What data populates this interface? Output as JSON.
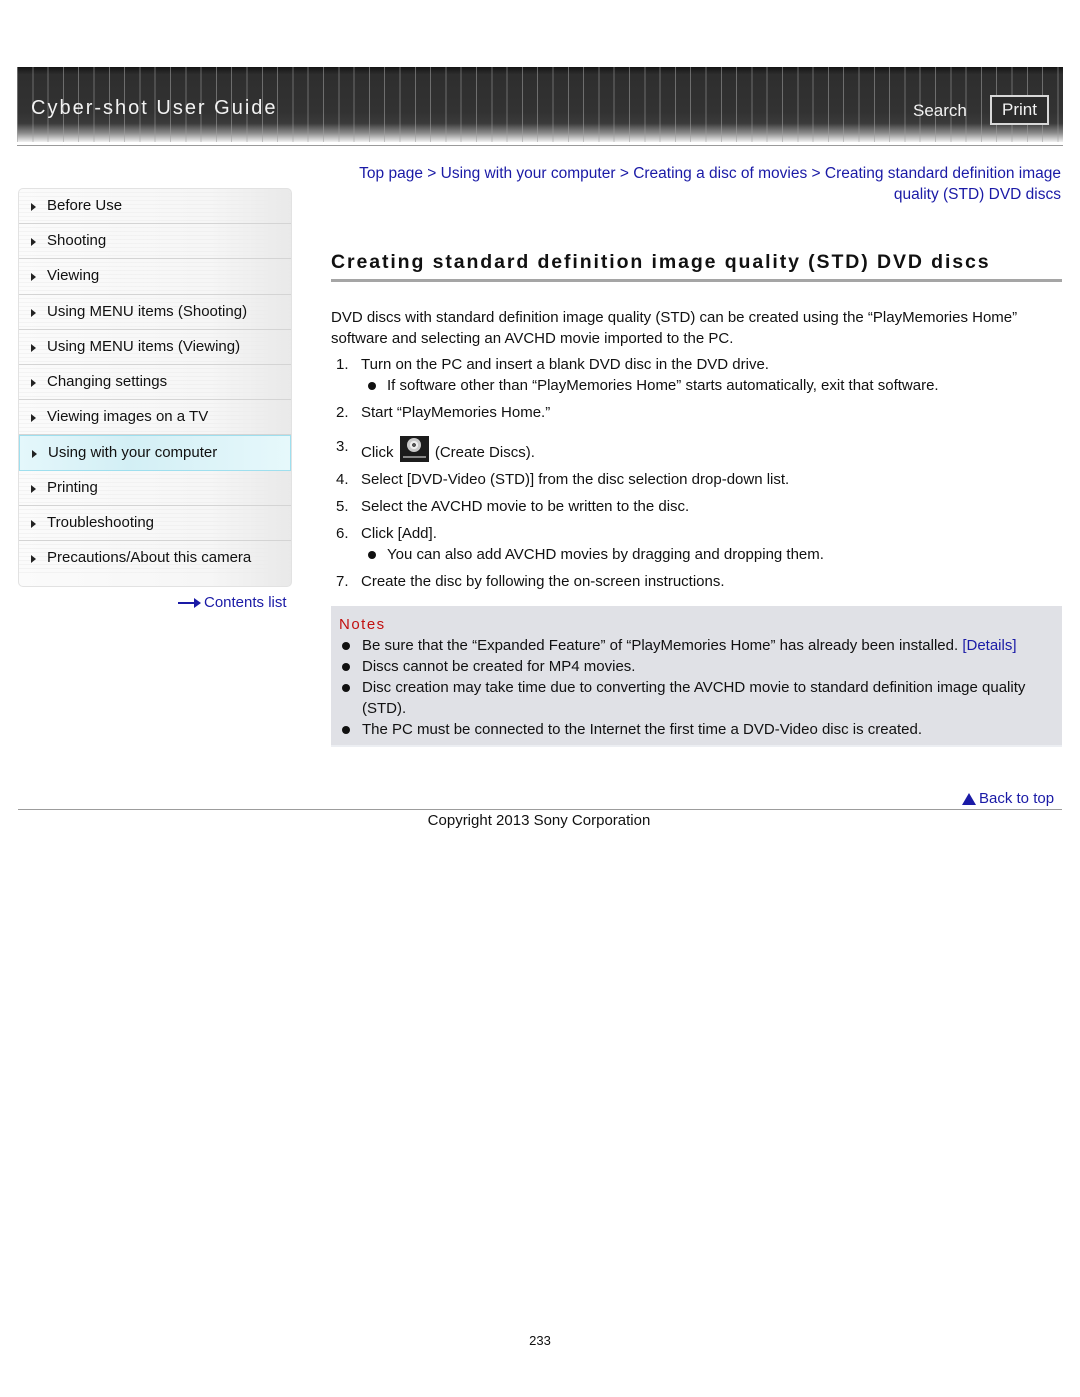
{
  "header": {
    "title": "Cyber-shot User Guide",
    "search_label": "Search",
    "print_label": "Print"
  },
  "sidebar": {
    "items": [
      {
        "label": "Before Use",
        "active": false
      },
      {
        "label": "Shooting",
        "active": false
      },
      {
        "label": "Viewing",
        "active": false
      },
      {
        "label": "Using MENU items (Shooting)",
        "active": false
      },
      {
        "label": "Using MENU items (Viewing)",
        "active": false
      },
      {
        "label": "Changing settings",
        "active": false
      },
      {
        "label": "Viewing images on a TV",
        "active": false
      },
      {
        "label": "Using with your computer",
        "active": true
      },
      {
        "label": "Printing",
        "active": false
      },
      {
        "label": "Troubleshooting",
        "active": false
      },
      {
        "label": "Precautions/About this camera",
        "active": false
      }
    ],
    "contents_link": "Contents list"
  },
  "breadcrumb": {
    "items": [
      "Top page",
      "Using with your computer",
      "Creating a disc of movies",
      "Creating standard definition image quality (STD) DVD discs"
    ],
    "separator": ">"
  },
  "main": {
    "title": "Creating standard definition image quality (STD) DVD discs",
    "intro": "DVD discs with standard definition image quality (STD) can be created using the “PlayMemories Home” software and selecting an AVCHD movie imported to the PC.",
    "steps": [
      {
        "num": "1.",
        "text": "Turn on the PC and insert a blank DVD disc in the DVD drive.",
        "sub": "If software other than “PlayMemories Home” starts automatically, exit that software."
      },
      {
        "num": "2.",
        "text": "Start “PlayMemories Home.”"
      },
      {
        "num": "3.",
        "text_before": "Click",
        "icon": "create-discs-icon",
        "text_after": "(Create Discs)."
      },
      {
        "num": "4.",
        "text": "Select [DVD-Video (STD)] from the disc selection drop-down list."
      },
      {
        "num": "5.",
        "text": "Select the AVCHD movie to be written to the disc."
      },
      {
        "num": "6.",
        "text": "Click [Add].",
        "sub": "You can also add AVCHD movies by dragging and dropping them."
      },
      {
        "num": "7.",
        "text": "Create the disc by following the on-screen instructions."
      }
    ]
  },
  "notes": {
    "title": "Notes",
    "items": [
      {
        "text": "Be sure that the “Expanded Feature” of “PlayMemories Home” has already been installed.",
        "link": "[Details]"
      },
      {
        "text": "Discs cannot be created for MP4 movies."
      },
      {
        "text": "Disc creation may take time due to converting the AVCHD movie to standard definition image quality (STD)."
      },
      {
        "text": "The PC must be connected to the Internet the first time a DVD-Video disc is created."
      }
    ]
  },
  "footer": {
    "back_to_top": "Back to top",
    "copyright": "Copyright 2013 Sony Corporation",
    "page_number": "233"
  },
  "colors": {
    "link": "#1a1aa6",
    "notes_title": "#c21010",
    "notes_bg": "#e0e1e6",
    "active_item_bg": "#d3eff5"
  }
}
